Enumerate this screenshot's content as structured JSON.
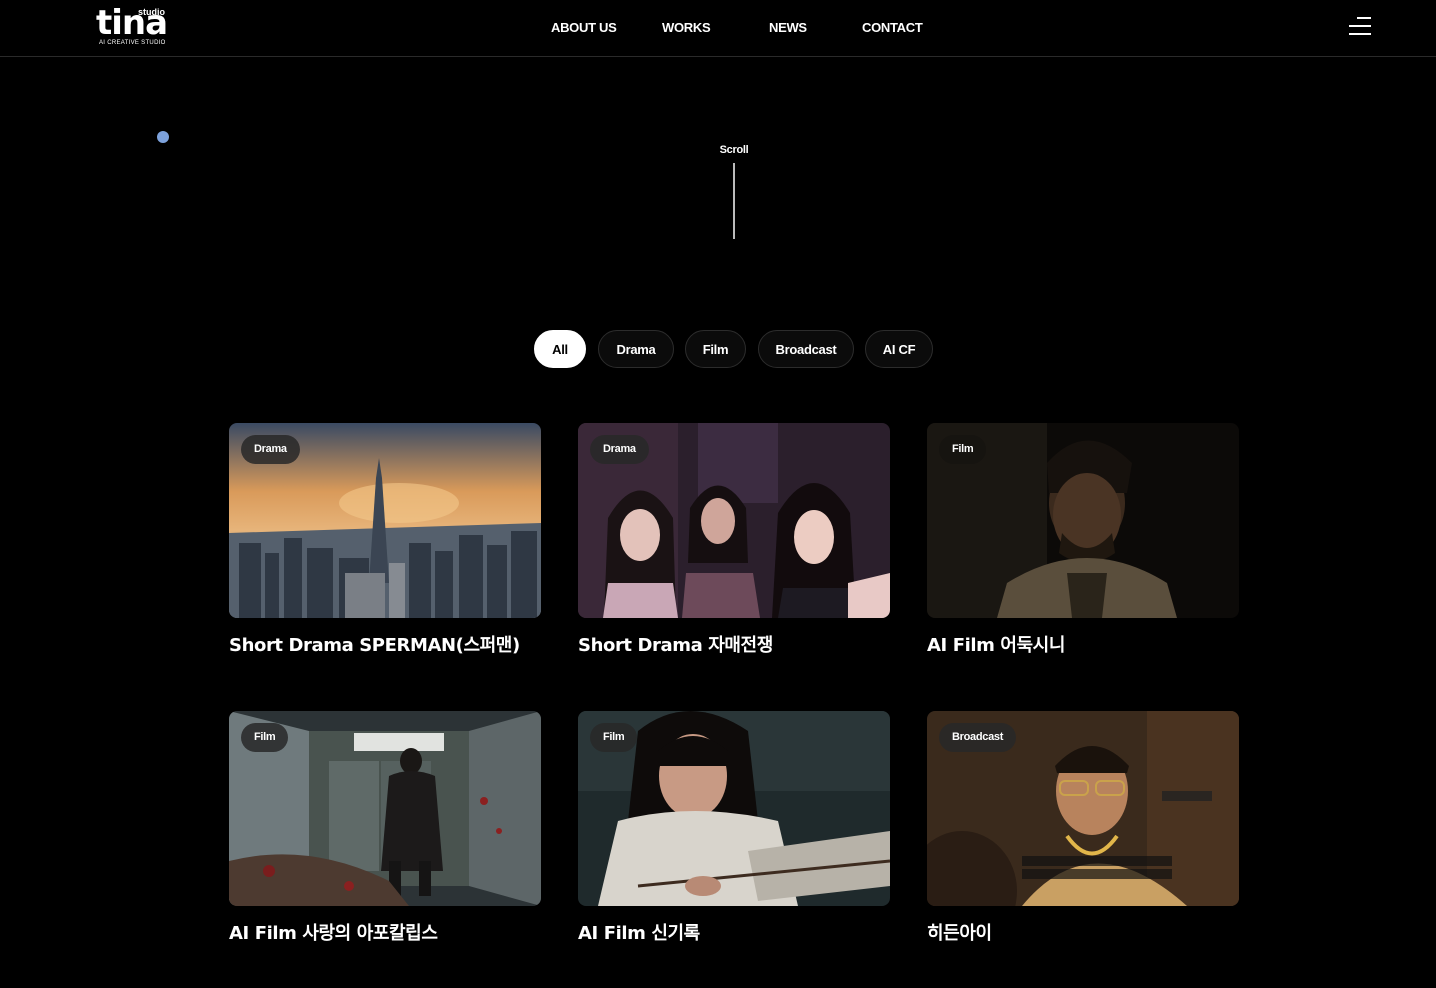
{
  "brand": {
    "name": "tina",
    "sub": "studio",
    "tagline": "AI CREATIVE STUDIO"
  },
  "nav": {
    "items": [
      "ABOUT US",
      "WORKS",
      "NEWS",
      "CONTACT"
    ]
  },
  "hero": {
    "scroll_label": "Scroll"
  },
  "filters": {
    "items": [
      "All",
      "Drama",
      "Film",
      "Broadcast",
      "AI CF"
    ],
    "active": "All"
  },
  "works": [
    {
      "category": "Drama",
      "title": "Short Drama SPERMAN(스퍼맨)"
    },
    {
      "category": "Drama",
      "title": "Short Drama 자매전쟁"
    },
    {
      "category": "Film",
      "title": "AI Film 어둑시니"
    },
    {
      "category": "Film",
      "title": "AI Film 사랑의 아포칼립스"
    },
    {
      "category": "Film",
      "title": "AI Film 신기록"
    },
    {
      "category": "Broadcast",
      "title": "히든아이"
    }
  ],
  "colors": {
    "background": "#000000",
    "accent_dot": "#7da2dc",
    "active_filter": "#ffffff"
  }
}
